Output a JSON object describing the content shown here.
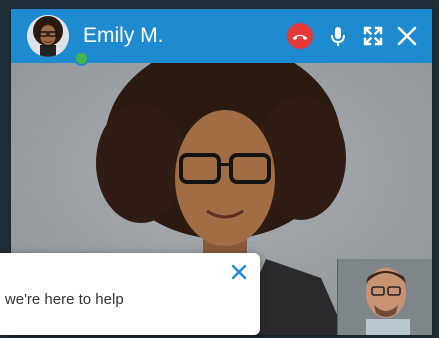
{
  "call": {
    "caller_name": "Emily M.",
    "presence_status": "online",
    "colors": {
      "titlebar": "#1e8ad0",
      "hangup": "#e53935",
      "presence": "#43b649"
    }
  },
  "controls": {
    "hangup_icon": "phone-hangup-icon",
    "mic_icon": "microphone-icon",
    "fullscreen_icon": "fullscreen-icon",
    "close_icon": "close-icon"
  },
  "chat": {
    "message": "y, we're here to help!",
    "close_icon": "close-icon"
  }
}
